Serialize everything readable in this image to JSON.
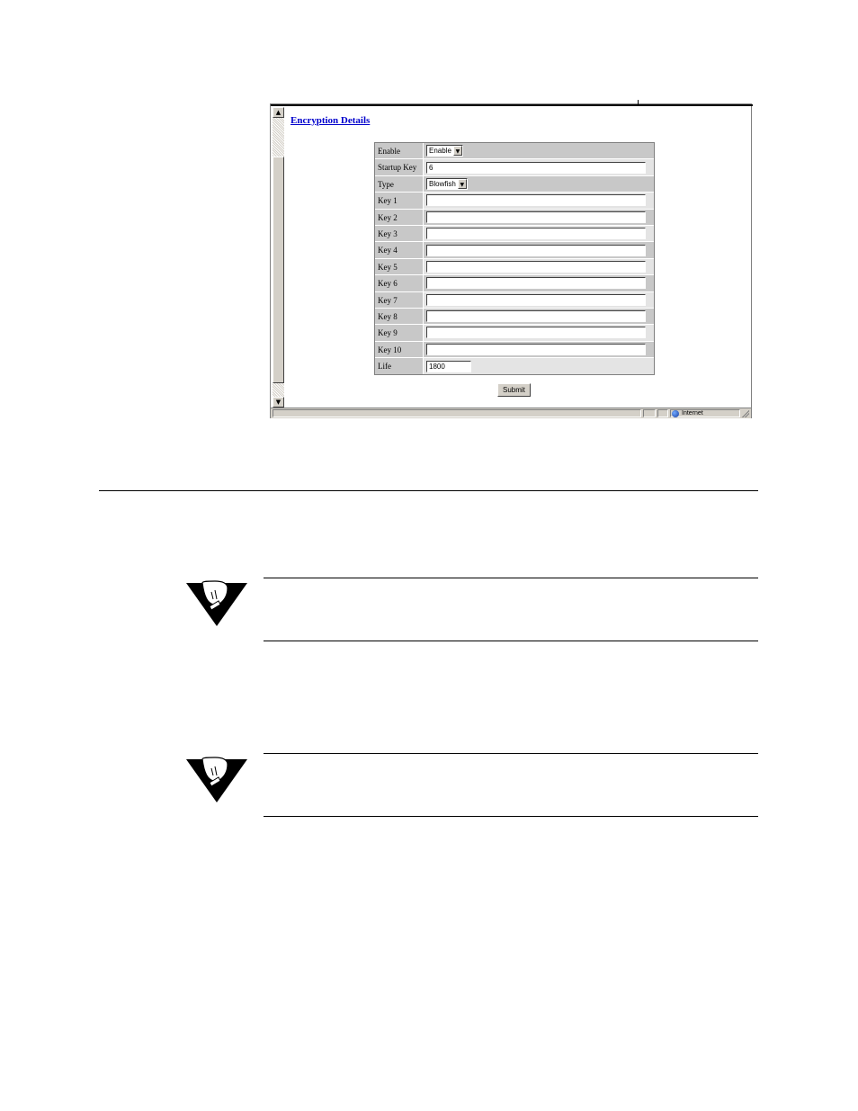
{
  "window": {
    "page_title": "Encryption Details",
    "form_rows": [
      {
        "label": "Enable",
        "kind": "select",
        "value": "Enable"
      },
      {
        "label": "Startup Key",
        "kind": "input",
        "value": "6"
      },
      {
        "label": "Type",
        "kind": "select",
        "value": "Blowfish"
      },
      {
        "label": "Key 1",
        "kind": "input",
        "value": ""
      },
      {
        "label": "Key 2",
        "kind": "input",
        "value": ""
      },
      {
        "label": "Key 3",
        "kind": "input",
        "value": ""
      },
      {
        "label": "Key 4",
        "kind": "input",
        "value": ""
      },
      {
        "label": "Key 5",
        "kind": "input",
        "value": ""
      },
      {
        "label": "Key 6",
        "kind": "input",
        "value": ""
      },
      {
        "label": "Key 7",
        "kind": "input",
        "value": ""
      },
      {
        "label": "Key 8",
        "kind": "input",
        "value": ""
      },
      {
        "label": "Key 9",
        "kind": "input",
        "value": ""
      },
      {
        "label": "Key 10",
        "kind": "input",
        "value": ""
      },
      {
        "label": "Life",
        "kind": "input",
        "value": "1800"
      }
    ],
    "submit_label": "Submit",
    "status": {
      "zone": "Internet",
      "zone_icon": "globe-icon"
    }
  },
  "notes": [
    {
      "icon": "lightbulb-note-icon"
    },
    {
      "icon": "lightbulb-note-icon"
    }
  ],
  "colors": {
    "link": "#0000cc",
    "row_label_bg": "#c8c8c8",
    "row_alt_bg": "#e4e4e4",
    "chrome": "#d4d0c8"
  }
}
